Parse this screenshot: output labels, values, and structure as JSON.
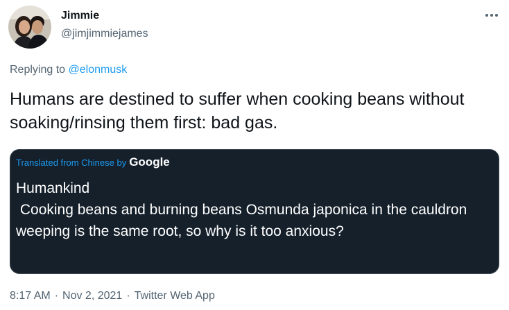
{
  "author": {
    "display_name": "Jimmie",
    "handle": "@jimjimmiejames",
    "avatar_icon": "profile-photo-icon"
  },
  "more_icon": "more-horizontal-icon",
  "reply": {
    "prefix": "Replying to",
    "mention": "@elonmusk"
  },
  "tweet_text": "Humans are destined to suffer when cooking beans without soaking/rinsing them first: bad gas.",
  "quote": {
    "translated_label": "Translated from Chinese by",
    "google_label": "Google",
    "translated_text": "Humankind\n Cooking beans and burning beans Osmunda japonica in the cauldron weeping is the same root, so why is it too anxious?"
  },
  "meta": {
    "time": "8:17 AM",
    "separator": "·",
    "date": "Nov 2, 2021",
    "source": "Twitter Web App"
  },
  "colors": {
    "link_blue": "#1d9bf0",
    "secondary_text": "#536471",
    "card_background": "#15202b",
    "primary_text": "#0f1419"
  }
}
